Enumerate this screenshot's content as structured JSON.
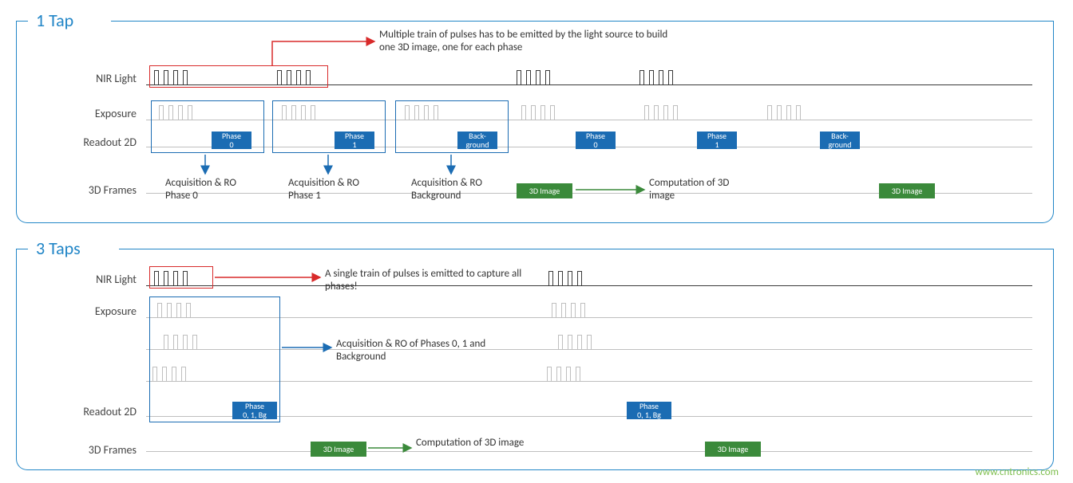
{
  "title_1tap": "1 Tap",
  "title_3taps": "3 Taps",
  "labels": {
    "nir": "NIR Light",
    "exposure": "Exposure",
    "readout": "Readout 2D",
    "frames": "3D Frames"
  },
  "notes": {
    "multi_pulse": "Multiple train of pulses has to be emitted by the light source to build one 3D image, one for each phase",
    "single_pulse": "A single train of pulses is emitted to capture all phases!",
    "acq_ro_phases": "Acquisition & RO of Phases 0, 1 and Background",
    "compute": "Computation of 3D image"
  },
  "phase": {
    "p0": "Phase\n0",
    "p1": "Phase\n1",
    "bg": "Back-\nground",
    "all": "Phase\n0, 1, Bg"
  },
  "acq": {
    "p0": "Acquisition & RO Phase 0",
    "p1": "Acquisition & RO Phase 1",
    "bg": "Acquisition & RO Background"
  },
  "img3d": "3D Image",
  "watermark": "www.cntronics.com"
}
